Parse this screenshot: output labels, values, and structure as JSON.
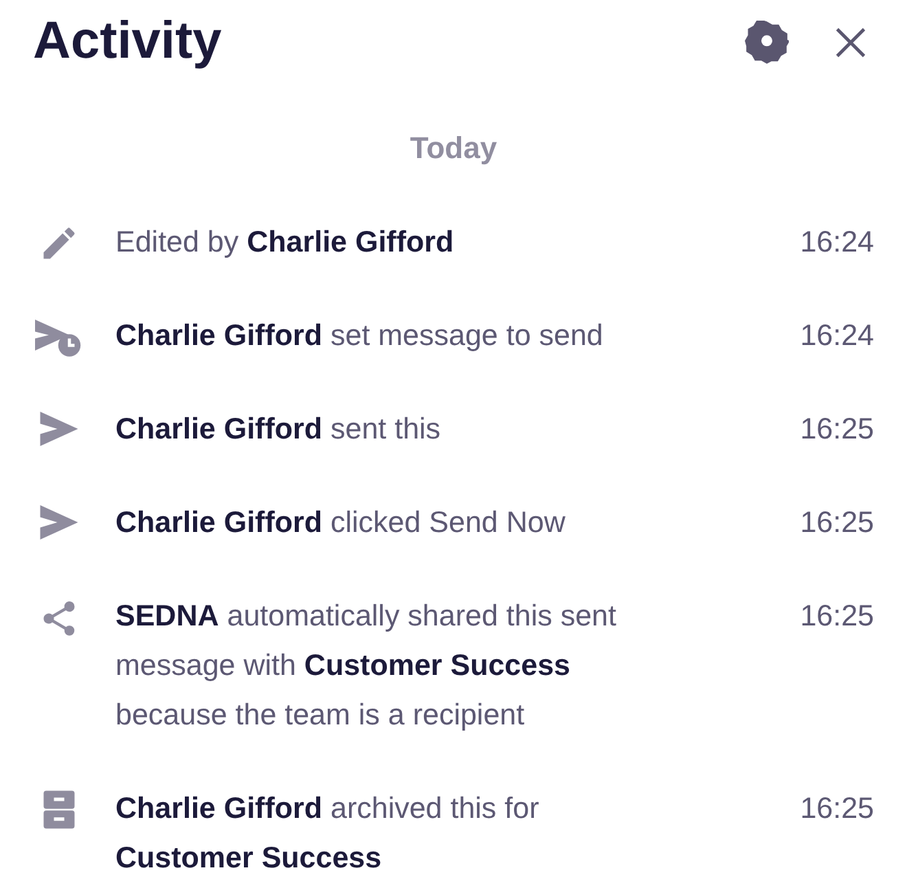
{
  "header": {
    "title": "Activity"
  },
  "section": {
    "label": "Today"
  },
  "events": [
    {
      "kind": "edit",
      "text": "Edited by **Charlie Gifford**",
      "time": "16:24"
    },
    {
      "kind": "schedule",
      "text": "**Charlie Gifford** set message to send",
      "time": "16:24"
    },
    {
      "kind": "send",
      "text": "**Charlie Gifford** sent this",
      "time": "16:25"
    },
    {
      "kind": "send",
      "text": "**Charlie Gifford** clicked Send Now",
      "time": "16:25"
    },
    {
      "kind": "share",
      "text": "**SEDNA** automatically shared this sent message with **Customer Success** because the team is a recipient",
      "time": "16:25"
    },
    {
      "kind": "archive",
      "text": "**Charlie Gifford** archived this for **Customer Success**",
      "time": "16:25"
    }
  ]
}
